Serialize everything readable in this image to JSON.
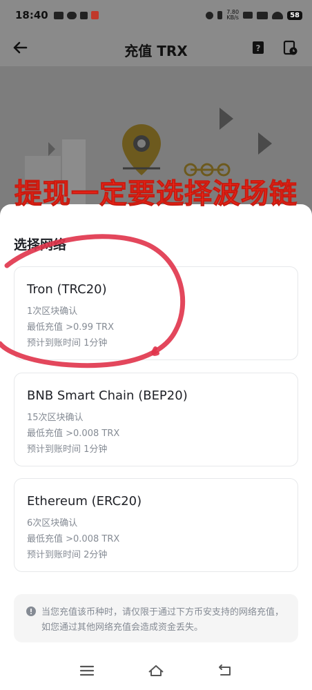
{
  "status_bar": {
    "time": "18:40",
    "speed_top": "7.80",
    "speed_bottom": "KB/s",
    "battery": "58"
  },
  "header": {
    "title": "充值 TRX"
  },
  "banner": {
    "text": "提现一定要选择波场链"
  },
  "sheet": {
    "title": "选择网络",
    "networks": [
      {
        "name": "Tron (TRC20)",
        "confirmations": "1次区块确认",
        "min_deposit": "最低充值 >0.99 TRX",
        "arrival": "预计到账时间 1分钟"
      },
      {
        "name": "BNB Smart Chain (BEP20)",
        "confirmations": "15次区块确认",
        "min_deposit": "最低充值 >0.008 TRX",
        "arrival": "预计到账时间 1分钟"
      },
      {
        "name": "Ethereum (ERC20)",
        "confirmations": "6次区块确认",
        "min_deposit": "最低充值 >0.008 TRX",
        "arrival": "预计到账时间 2分钟"
      }
    ],
    "notice": "当您充值该币种时，请仅限于通过下方币安支持的网络充值，如您通过其他网络充值会造成资金丢失。"
  },
  "colors": {
    "banner_red": "#ff2a1e",
    "annotation_red": "#e0334a",
    "accent_yellow": "#f0b90b"
  },
  "icons": [
    "back-arrow-icon",
    "help-doc-icon",
    "history-icon",
    "info-icon",
    "menu-icon",
    "home-icon",
    "back-nav-icon",
    "location-pin-icon"
  ]
}
